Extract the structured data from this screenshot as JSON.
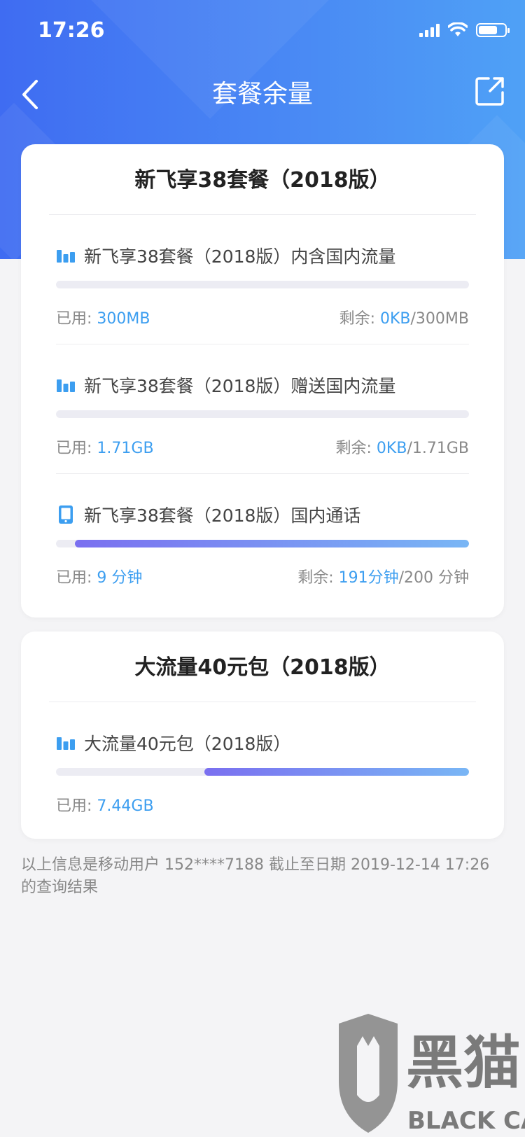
{
  "status": {
    "time": "17:26"
  },
  "nav": {
    "title": "套餐余量"
  },
  "plans": [
    {
      "title": "新飞享38套餐（2018版）",
      "items": [
        {
          "icon": "bar-chart-icon",
          "name": "新飞享38套餐（2018版）内含国内流量",
          "used_label": "已用: ",
          "used_value": "300MB",
          "remain_label": "剩余: ",
          "remain_value": "0KB",
          "total": "/300MB",
          "progress_remaining_fraction": 0
        },
        {
          "icon": "bar-chart-icon",
          "name": "新飞享38套餐（2018版）赠送国内流量",
          "used_label": "已用: ",
          "used_value": "1.71GB",
          "remain_label": "剩余: ",
          "remain_value": "0KB",
          "total": "/1.71GB",
          "progress_remaining_fraction": 0
        },
        {
          "icon": "phone-icon",
          "name": "新飞享38套餐（2018版）国内通话",
          "used_label": "已用: ",
          "used_value": "9 分钟",
          "remain_label": "剩余: ",
          "remain_value": "191分钟",
          "total": "/200 分钟",
          "progress_remaining_fraction": 0.955
        }
      ]
    },
    {
      "title": "大流量40元包（2018版）",
      "items": [
        {
          "icon": "bar-chart-icon",
          "name": "大流量40元包（2018版）",
          "used_label": "已用: ",
          "used_value": "7.44GB",
          "progress_remaining_fraction": 0.64
        }
      ]
    }
  ],
  "footnote": "以上信息是移动用户 152****7188 截止至日期 2019-12-14 17:26的查询结果",
  "watermark": {
    "text_cn": "黑猫",
    "text_en": "BLACK CAT"
  },
  "colors": {
    "header_start": "#3f6cf2",
    "header_end": "#4fa1f6",
    "accent": "#3c9ef0",
    "bar_start": "#7a6ff0",
    "bar_end": "#79b6f5"
  }
}
